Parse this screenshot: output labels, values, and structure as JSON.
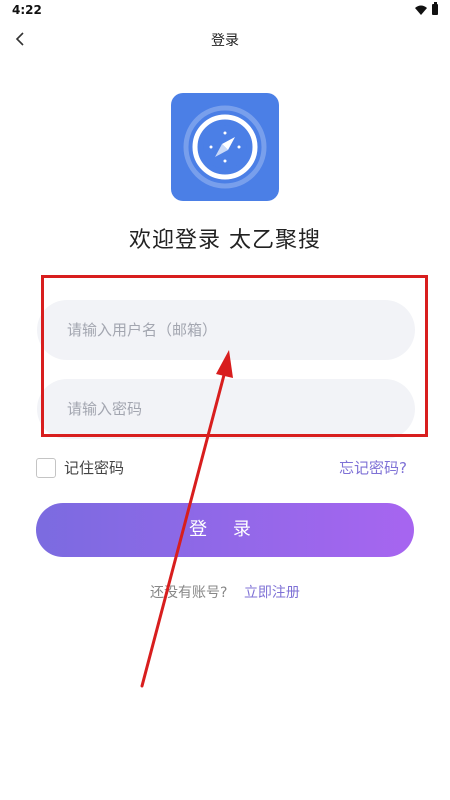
{
  "status_bar": {
    "time": "4:22"
  },
  "header": {
    "title": "登录"
  },
  "app": {
    "title": "欢迎登录 太乙聚搜"
  },
  "form": {
    "username_placeholder": "请输入用户名（邮箱）",
    "password_placeholder": "请输入密码",
    "username_value": "",
    "password_value": "",
    "remember_label": "记住密码",
    "remember_checked": false,
    "forgot_label": "忘记密码?",
    "login_label": "登 录"
  },
  "register": {
    "prompt": "还没有账号?",
    "link": "立即注册"
  },
  "icons": {
    "back": "chevron-left-icon",
    "logo": "compass-icon",
    "wifi": "wifi-icon",
    "battery": "battery-icon"
  },
  "colors": {
    "accent": "#7f72d6",
    "button_start": "#7b6be0",
    "button_end": "#a765f0",
    "logo_bg": "#4b7fe6",
    "annotation": "#d81e1e"
  }
}
